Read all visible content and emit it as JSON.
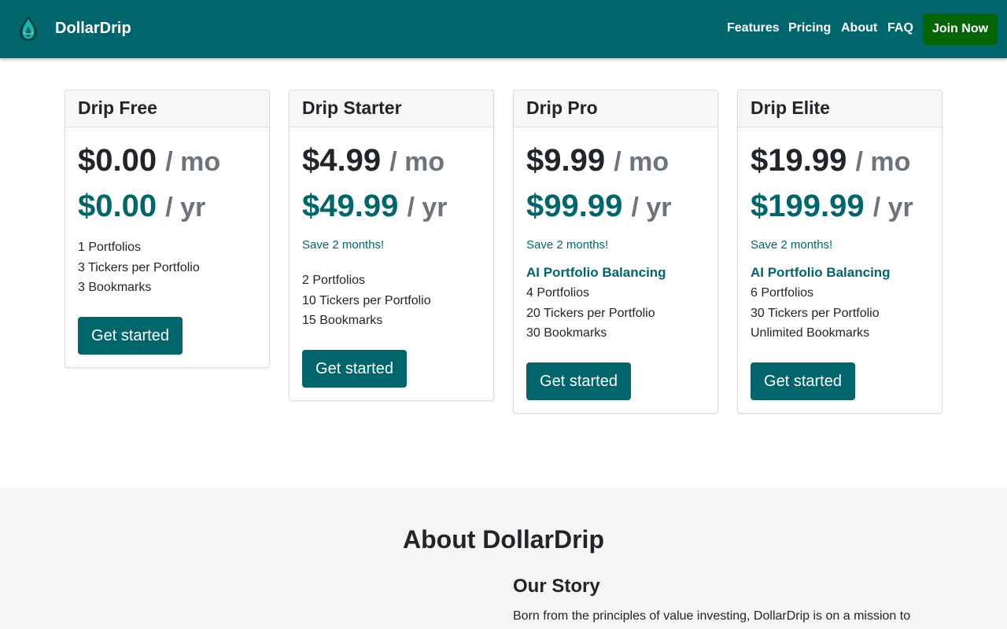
{
  "nav": {
    "brand": "DollarDrip",
    "links": [
      "Features",
      "Pricing",
      "About",
      "FAQ"
    ],
    "join_label": "Join Now"
  },
  "colors": {
    "brand": "#00666b",
    "join": "#056405"
  },
  "plans": [
    {
      "name": "Drip Free",
      "price_mo": "$0.00",
      "price_yr": "$0.00",
      "unit_mo": "/ mo",
      "unit_yr": "/ yr",
      "save": "",
      "highlight": "",
      "features": [
        "1 Portfolios",
        "3 Tickers per Portfolio",
        "3 Bookmarks"
      ],
      "cta": "Get started"
    },
    {
      "name": "Drip Starter",
      "price_mo": "$4.99",
      "price_yr": "$49.99",
      "unit_mo": "/ mo",
      "unit_yr": "/ yr",
      "save": "Save 2 months!",
      "highlight": "",
      "features": [
        "2 Portfolios",
        "10 Tickers per Portfolio",
        "15 Bookmarks"
      ],
      "cta": "Get started"
    },
    {
      "name": "Drip Pro",
      "price_mo": "$9.99",
      "price_yr": "$99.99",
      "unit_mo": "/ mo",
      "unit_yr": "/ yr",
      "save": "Save 2 months!",
      "highlight": "AI Portfolio Balancing",
      "features": [
        "4 Portfolios",
        "20 Tickers per Portfolio",
        "30 Bookmarks"
      ],
      "cta": "Get started"
    },
    {
      "name": "Drip Elite",
      "price_mo": "$19.99",
      "price_yr": "$199.99",
      "unit_mo": "/ mo",
      "unit_yr": "/ yr",
      "save": "Save 2 months!",
      "highlight": "AI Portfolio Balancing",
      "features": [
        "6 Portfolios",
        "30 Tickers per Portfolio",
        "Unlimited Bookmarks"
      ],
      "cta": "Get started"
    }
  ],
  "about": {
    "title": "About DollarDrip",
    "story_title": "Our Story",
    "story_text": "Born from the principles of value investing, DollarDrip is on a mission to"
  }
}
